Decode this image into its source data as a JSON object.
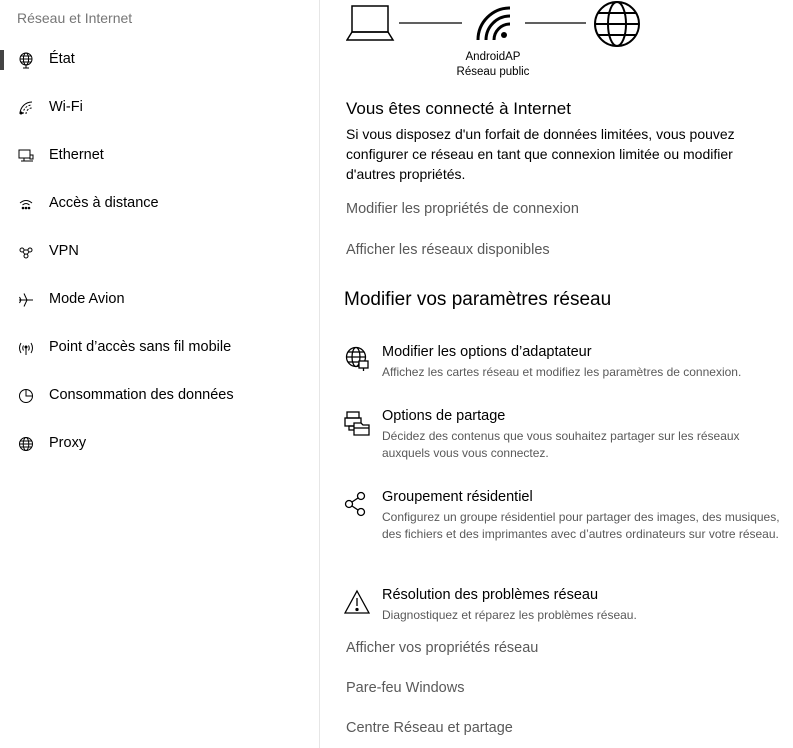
{
  "sidebar": {
    "title": "Réseau et Internet",
    "items": [
      {
        "label": "État",
        "icon": "globe-icon",
        "selected": true
      },
      {
        "label": "Wi-Fi",
        "icon": "wifi-icon"
      },
      {
        "label": "Ethernet",
        "icon": "ethernet-icon"
      },
      {
        "label": "Accès à distance",
        "icon": "dialup-icon"
      },
      {
        "label": "VPN",
        "icon": "vpn-icon"
      },
      {
        "label": "Mode Avion",
        "icon": "airplane-icon"
      },
      {
        "label": "Point d’accès sans fil mobile",
        "icon": "hotspot-icon"
      },
      {
        "label": "Consommation des données",
        "icon": "data-usage-icon"
      },
      {
        "label": "Proxy",
        "icon": "proxy-globe-icon"
      }
    ]
  },
  "status": {
    "network_name": "AndroidAP",
    "network_type": "Réseau public",
    "connected_heading": "Vous êtes connecté à Internet",
    "connected_text": "Si vous disposez d'un forfait de données limitées, vous pouvez configurer ce réseau en tant que connexion limitée ou modifier d'autres propriétés.",
    "link_properties": "Modifier les propriétés de connexion",
    "link_available": "Afficher les réseaux disponibles"
  },
  "settings": {
    "heading": "Modifier vos paramètres réseau",
    "options": [
      {
        "title": "Modifier les options d’adaptateur",
        "desc": "Affichez les cartes réseau et modifiez les paramètres de connexion.",
        "icon": "adapter-icon"
      },
      {
        "title": "Options de partage",
        "desc": "Décidez des contenus que vous souhaitez partager sur les réseaux auxquels vous vous connectez.",
        "icon": "sharing-icon"
      },
      {
        "title": "Groupement résidentiel",
        "desc": "Configurez un groupe résidentiel pour partager des images, des musiques, des fichiers et des imprimantes avec d’autres ordinateurs sur votre réseau.",
        "icon": "homegroup-icon"
      },
      {
        "title": "Résolution des problèmes réseau",
        "desc": "Diagnostiquez et réparez les problèmes réseau.",
        "icon": "warning-icon"
      }
    ],
    "links": [
      "Afficher vos propriétés réseau",
      "Pare-feu Windows",
      "Centre Réseau et partage"
    ]
  }
}
